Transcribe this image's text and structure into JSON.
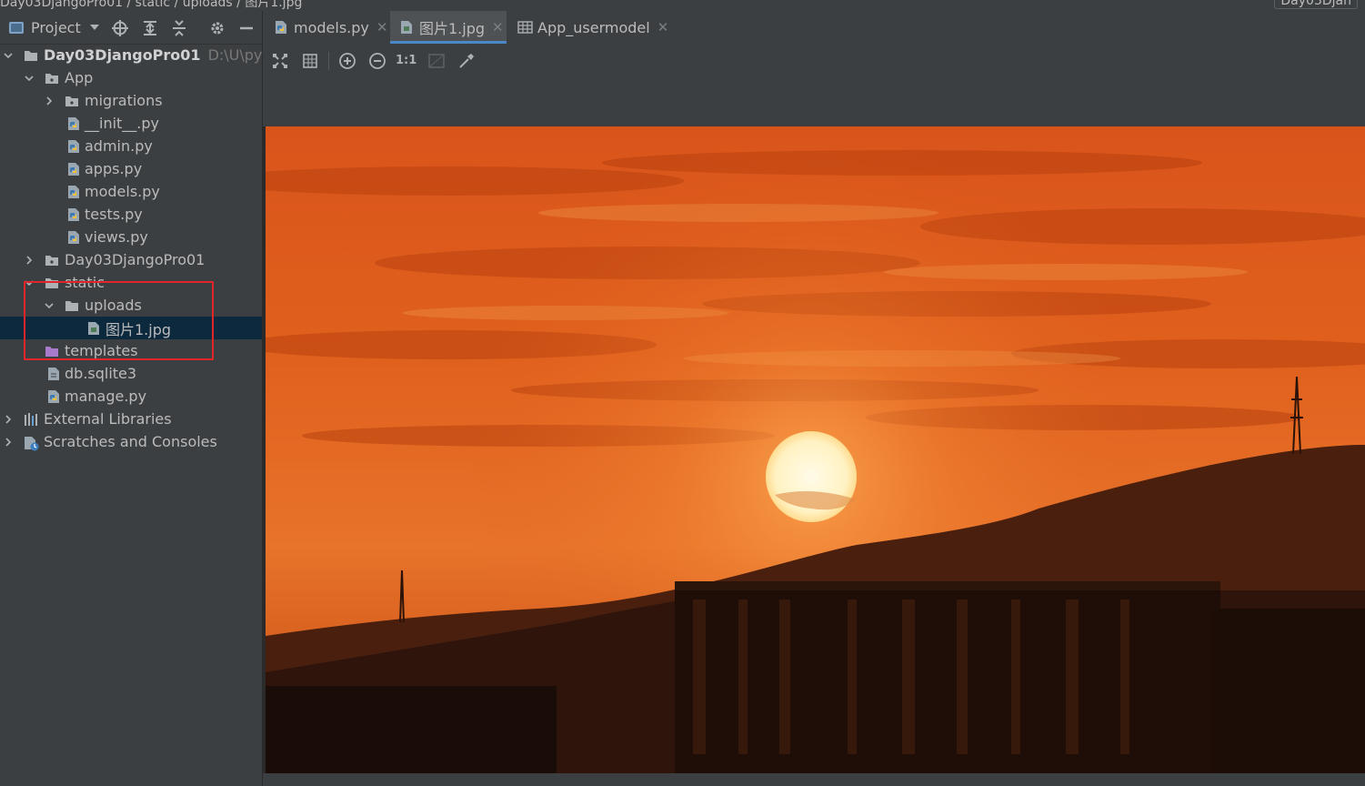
{
  "breadcrumb": {
    "left": "Day03DjangoPro01 / static / uploads / 图片1.jpg",
    "right": "Day03Djan"
  },
  "project_panel": {
    "title": "Project",
    "tools": [
      "locate-icon",
      "expand-all-icon",
      "collapse-all-icon",
      "gear-icon",
      "hide-icon"
    ]
  },
  "tree": [
    {
      "label": "Day03DjangoPro01",
      "path": "D:\\U\\python",
      "kind": "project-folder",
      "expanded": true,
      "depth": 0
    },
    {
      "label": "App",
      "kind": "folder",
      "expanded": true,
      "depth": 1
    },
    {
      "label": "migrations",
      "kind": "folder",
      "expanded": false,
      "depth": 2
    },
    {
      "label": "__init__.py",
      "kind": "python-file",
      "depth": 2
    },
    {
      "label": "admin.py",
      "kind": "python-file",
      "depth": 2
    },
    {
      "label": "apps.py",
      "kind": "python-file",
      "depth": 2
    },
    {
      "label": "models.py",
      "kind": "python-file",
      "depth": 2
    },
    {
      "label": "tests.py",
      "kind": "python-file",
      "depth": 2
    },
    {
      "label": "views.py",
      "kind": "python-file",
      "depth": 2
    },
    {
      "label": "Day03DjangoPro01",
      "kind": "folder",
      "expanded": false,
      "depth": 1
    },
    {
      "label": "static",
      "kind": "folder",
      "expanded": true,
      "depth": 1
    },
    {
      "label": "uploads",
      "kind": "folder",
      "expanded": true,
      "depth": 2
    },
    {
      "label": "图片1.jpg",
      "kind": "image-file",
      "depth": 3,
      "selected": true
    },
    {
      "label": "templates",
      "kind": "template-folder",
      "depth": 1
    },
    {
      "label": "db.sqlite3",
      "kind": "db-file",
      "depth": 1
    },
    {
      "label": "manage.py",
      "kind": "python-file",
      "depth": 1
    },
    {
      "label": "External Libraries",
      "kind": "libraries",
      "expanded": false,
      "depth": 0
    },
    {
      "label": "Scratches and Consoles",
      "kind": "scratches",
      "expanded": false,
      "depth": 0
    }
  ],
  "tabs": [
    {
      "label": "models.py",
      "icon": "python-file-icon",
      "active": false
    },
    {
      "label": "图片1.jpg",
      "icon": "image-file-icon",
      "active": true
    },
    {
      "label": "App_usermodel",
      "icon": "table-icon",
      "active": false
    }
  ],
  "image_toolbar": [
    "fit-icon",
    "grid-icon",
    "zoom-in-icon",
    "zoom-out-icon",
    "1:1",
    "background-icon",
    "color-picker-icon"
  ],
  "colors": {
    "panel_bg": "#3c3f41",
    "editor_bg": "#2b2b2b",
    "selection": "#0d293e",
    "highlight_box": "#e0262a",
    "tab_underline": "#4a88c7"
  }
}
